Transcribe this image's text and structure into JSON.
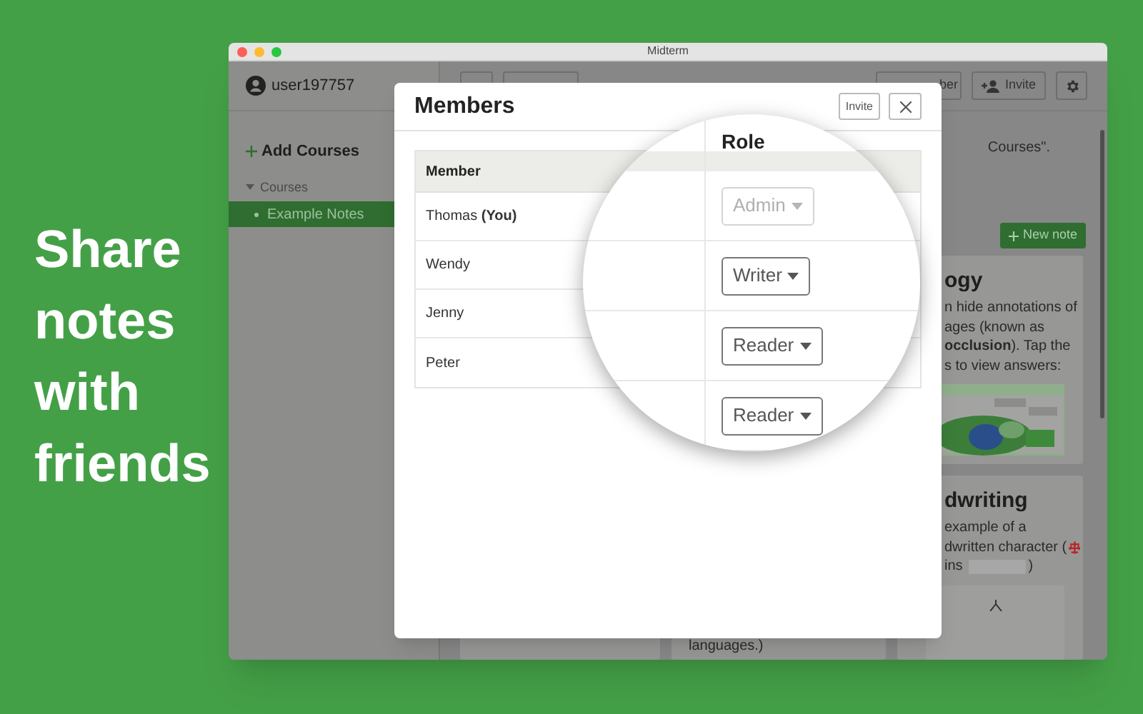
{
  "page": {
    "headline": "Share notes with friends"
  },
  "window": {
    "title": "Midterm"
  },
  "sidebar": {
    "user": "user197757",
    "add_button": "Add Courses",
    "sections": [
      {
        "label": "Courses",
        "expanded": true,
        "children": [
          {
            "label": "Example Notes",
            "selected": true
          }
        ]
      }
    ]
  },
  "toolbar": {
    "member_button": "ber",
    "invite_button": "Invite"
  },
  "main": {
    "hint": "Courses\".",
    "new_note_button": "New note",
    "cards": [
      {
        "title": "ogy",
        "lines": [
          {
            "text": "n hide annotations of",
            "kind": "text"
          },
          {
            "text": "ages (known as",
            "kind": "text"
          },
          {
            "text": "**occlusion**). Tap the",
            "kind": "text"
          },
          {
            "text": "s to view answers:",
            "kind": "text"
          }
        ]
      },
      {
        "title": "dwriting",
        "kind": "canvas",
        "lines": [
          {
            "text": "example of a",
            "kind": "text"
          },
          {
            "text": "dwritten character (",
            "kind": "glyph"
          },
          {
            "text": "ins",
            "kind": "blank",
            "after": ")"
          }
        ]
      }
    ],
    "footer_text": "languages.)"
  },
  "dialog": {
    "title": "Members",
    "invite_button": "Invite",
    "columns": [
      "Member",
      "Role"
    ],
    "rows": [
      {
        "member": "Thomas **(You)**",
        "role": "Admin",
        "disabled": true
      },
      {
        "member": "Wendy",
        "role": "Writer",
        "disabled": false
      },
      {
        "member": "Jenny",
        "role": "Reader",
        "disabled": false
      },
      {
        "member": "Peter",
        "role": "Reader",
        "disabled": false
      }
    ]
  }
}
